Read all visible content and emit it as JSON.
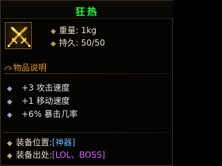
{
  "item": {
    "name": "狂热",
    "icon": "crossed-swords-icon",
    "weight": "重量: 1kg",
    "durability": "持久: 50/50"
  },
  "description": {
    "header": "物品说明",
    "attributes": [
      {
        "label": "+3  攻击速度"
      },
      {
        "label": "+1  移动速度"
      },
      {
        "label": "+6%  暴击几率"
      }
    ]
  },
  "equip": {
    "slot_label": "装备位置:",
    "slot_value": "[神器]",
    "source_label": "装备出处:",
    "source_value": "[LOL、BOSS]"
  },
  "colors": {
    "title": "#35ea46",
    "header": "#e39a2b",
    "slot": "#6db6ff",
    "source": "#d46bff"
  }
}
